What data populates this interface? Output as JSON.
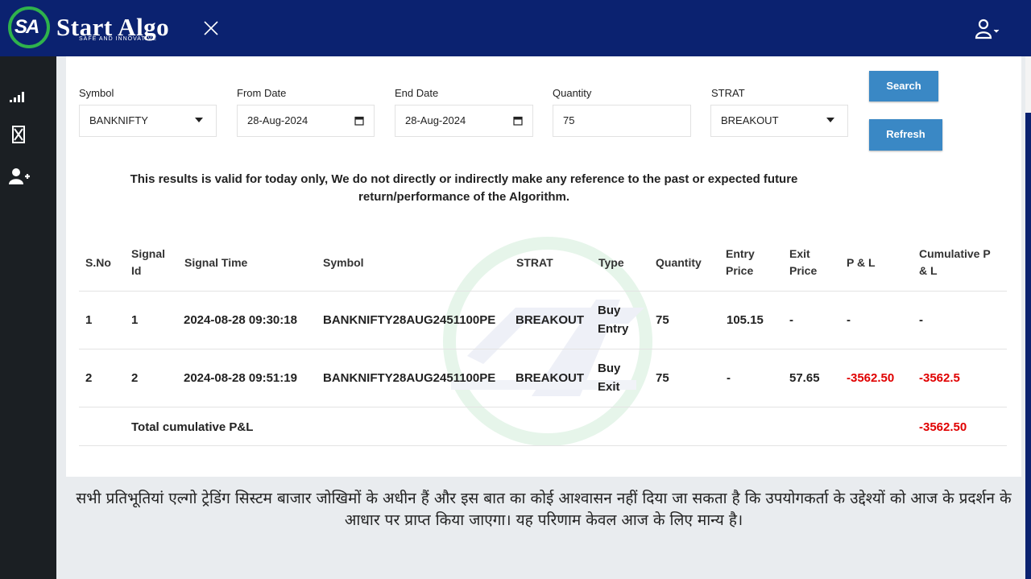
{
  "header": {
    "brand": "Start Algo",
    "logo_mark": "SA",
    "tagline": "SAFE AND INNOVATIVE",
    "close_icon": "close-icon",
    "user_icon": "user-icon"
  },
  "sidebar": {
    "items": [
      {
        "icon": "signal-bars-icon"
      },
      {
        "icon": "hourglass-icon"
      },
      {
        "icon": "add-user-icon"
      }
    ]
  },
  "filters": {
    "symbol": {
      "label": "Symbol",
      "value": "BANKNIFTY"
    },
    "from_date": {
      "label": "From Date",
      "value": "28-Aug-2024"
    },
    "end_date": {
      "label": "End Date",
      "value": "28-Aug-2024"
    },
    "quantity": {
      "label": "Quantity",
      "value": "75"
    },
    "strat": {
      "label": "STRAT",
      "value": "BREAKOUT"
    },
    "search_label": "Search",
    "refresh_label": "Refresh"
  },
  "notice": "This results is valid for today only, We do not directly or indirectly make any reference to the past or expected future return/performance of the Algorithm.",
  "table": {
    "headers": {
      "sno": "S.No",
      "signal_id": "Signal Id",
      "signal_time": "Signal Time",
      "symbol": "Symbol",
      "strat": "STRAT",
      "type": "Type",
      "quantity": "Quantity",
      "entry_price": "Entry Price",
      "exit_price": "Exit Price",
      "pnl": "P & L",
      "cum_pnl": "Cumulative P & L"
    },
    "rows": [
      {
        "sno": "1",
        "signal_id": "1",
        "signal_time": "2024-08-28 09:30:18",
        "symbol": "BANKNIFTY28AUG2451100PE",
        "strat": "BREAKOUT",
        "type": "Buy Entry",
        "quantity": "75",
        "entry_price": "105.15",
        "exit_price": "-",
        "pnl": "-",
        "cum_pnl": "-"
      },
      {
        "sno": "2",
        "signal_id": "2",
        "signal_time": "2024-08-28 09:51:19",
        "symbol": "BANKNIFTY28AUG2451100PE",
        "strat": "BREAKOUT",
        "type": "Buy Exit",
        "quantity": "75",
        "entry_price": "-",
        "exit_price": "57.65",
        "pnl": "-3562.50",
        "cum_pnl": "-3562.5"
      }
    ],
    "total_label": "Total cumulative P&L",
    "total_value": "-3562.50"
  },
  "disclaimer_hindi": "सभी प्रतिभूतियां एल्गो ट्रेडिंग सिस्टम बाजार जोखिमों के अधीन हैं और इस बात का कोई आश्वासन नहीं दिया जा सकता है कि उपयोगकर्ता के उद्देश्यों को आज के प्रदर्शन के आधार पर प्राप्त किया जाएगा। यह परिणाम केवल आज के लिए मान्य है।",
  "colors": {
    "header_bg": "#0b2270",
    "sidebar_bg": "#1b1f23",
    "button_bg": "#3a88c5",
    "logo_ring": "#2fb24c",
    "negative": "#e00000"
  }
}
